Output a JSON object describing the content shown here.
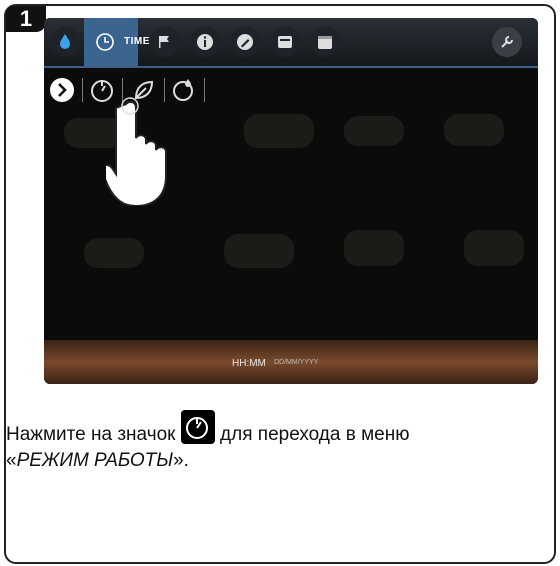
{
  "step_number": "1",
  "topbar": {
    "time_label": "TIME",
    "icons": [
      "drop-icon",
      "clock-icon",
      "flag-icon",
      "info-icon",
      "pen-icon",
      "card-icon",
      "calendar-icon",
      "wrench-icon"
    ]
  },
  "subbar": {
    "icons": [
      "chevron-right-icon",
      "clock-mode-icon",
      "leaf-icon",
      "timer-drop-icon"
    ]
  },
  "status": {
    "time": "HH:MM",
    "date": "DD/MM/YYYY"
  },
  "caption": {
    "before_icon": "Нажмите на значок ",
    "after_icon": " для перехода в меню",
    "line2_open": "«",
    "line2_mode": "РЕЖИМ РАБОТЫ",
    "line2_close": "»."
  },
  "colors": {
    "accent": "#3b648f",
    "bottom_bar": "#7a4a2c",
    "screen_bg": "#0b0b0c"
  }
}
